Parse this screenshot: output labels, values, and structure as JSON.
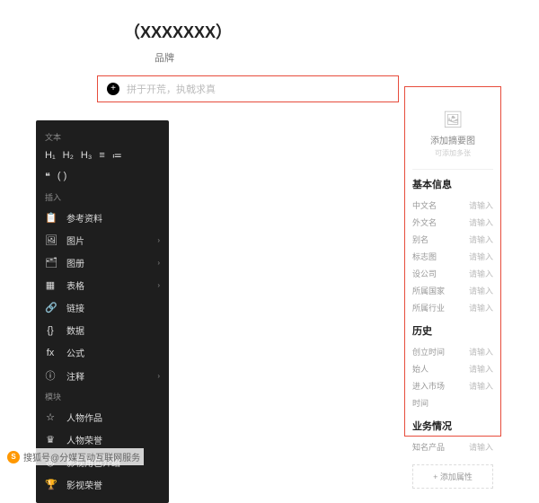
{
  "title": "（XXXXXXX）",
  "subtitle": "品牌",
  "input": {
    "placeholder": "拼于开荒，执戟求真"
  },
  "toolbar": {
    "text_section": "文本",
    "headings": [
      "H₁",
      "H₂",
      "H₃",
      "≡",
      "≔"
    ],
    "quote_row": [
      "❝",
      "( )"
    ],
    "insert_section": "插入",
    "insert_items": [
      {
        "icon": "📋",
        "label": "参考资料"
      },
      {
        "icon": "🖼",
        "label": "图片",
        "chevron": true
      },
      {
        "icon": "🗂",
        "label": "图册",
        "chevron": true
      },
      {
        "icon": "▦",
        "label": "表格",
        "chevron": true
      },
      {
        "icon": "🔗",
        "label": "链接"
      },
      {
        "icon": "{}",
        "label": "数据"
      },
      {
        "icon": "fx",
        "label": "公式"
      },
      {
        "icon": "ⓘ",
        "label": "注释",
        "chevron": true
      }
    ],
    "module_section": "模块",
    "module_items": [
      {
        "icon": "☆",
        "label": "人物作品"
      },
      {
        "icon": "♛",
        "label": "人物荣誉"
      },
      {
        "icon": "◎",
        "label": "影视角色介绍"
      },
      {
        "icon": "🏆",
        "label": "影视荣誉"
      }
    ]
  },
  "right_panel": {
    "image_label": "添加摘要图",
    "image_sub": "可添加多张",
    "section_basic": "基本信息",
    "basic_fields": [
      {
        "label": "中文名",
        "value": "请输入"
      },
      {
        "label": "外文名",
        "value": "请输入"
      },
      {
        "label": "别名",
        "value": "请输入"
      },
      {
        "label": "标志图",
        "value": "请输入"
      },
      {
        "label": "设公司",
        "value": "请输入"
      },
      {
        "label": "所属国家",
        "value": "请输入"
      },
      {
        "label": "所属行业",
        "value": "请输入"
      }
    ],
    "section_history": "历史",
    "history_fields": [
      {
        "label": "创立时间",
        "value": "请输入"
      },
      {
        "label": "始人",
        "value": "请输入"
      },
      {
        "label": "进入市场",
        "value": "请输入"
      },
      {
        "label": "时间",
        "value": ""
      }
    ],
    "section_biz": "业务情况",
    "biz_fields": [
      {
        "label": "知名产品",
        "value": "请输入"
      }
    ],
    "add_attr": "+ 添加属性"
  },
  "watermark": "搜狐号@分媒互动互联网服务"
}
